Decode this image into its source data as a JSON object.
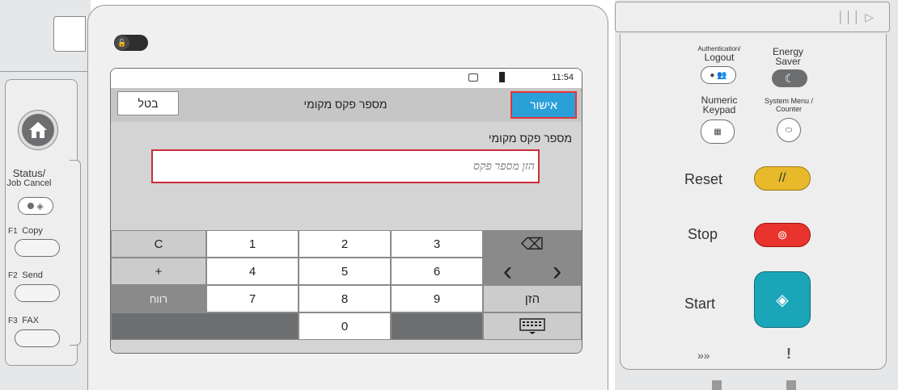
{
  "screen": {
    "status_time": "11:54",
    "cancel_label": "בטל",
    "title": "מספר פקס מקומי",
    "ok_label": "אישור",
    "field_label": "מספר פקס מקומי",
    "field_placeholder": "הזן מספר פקס",
    "field_value": ""
  },
  "keypad": {
    "clear": "C",
    "k1": "1",
    "k2": "2",
    "k3": "3",
    "k4": "4",
    "k5": "5",
    "k6": "6",
    "k7": "7",
    "k8": "8",
    "k9": "9",
    "k0": "0",
    "plus": "+",
    "space": "רווח",
    "enter": "הזן",
    "backspace_icon": "⌫",
    "left_arrow": "‹",
    "right_arrow": "›"
  },
  "left_panel": {
    "status_label": "Status/",
    "job_cancel_label": "Job Cancel",
    "f1_key": "F1",
    "f1_label": "Copy",
    "f2_key": "F2",
    "f2_label": "Send",
    "f3_key": "F3",
    "f3_label": "FAX"
  },
  "right_panel": {
    "auth_line1": "Authentication/",
    "auth_line2": "Logout",
    "energy_line1": "Energy",
    "energy_line2": "Saver",
    "numeric_line1": "Numeric",
    "numeric_line2": "Keypad",
    "sysmenu_line1": "System Menu /",
    "sysmenu_line2": "Counter",
    "reset_label": "Reset",
    "stop_label": "Stop",
    "start_label": "Start",
    "bottom_left_icon": "»»",
    "bottom_right_icon": "!"
  },
  "colors": {
    "ok_button": "#2b9fd8",
    "highlight_border": "#e8333a",
    "reset": "#e8b92b",
    "stop": "#e8342c",
    "start": "#1aa6b8"
  }
}
